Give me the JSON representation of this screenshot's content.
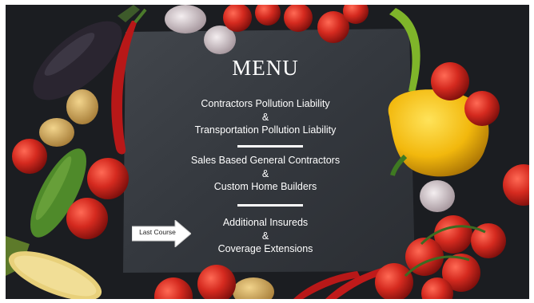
{
  "menu": {
    "title": "MENU",
    "groups": [
      {
        "line1": "Contractors Pollution Liability",
        "amp": "&",
        "line2": "Transportation Pollution Liability"
      },
      {
        "line1": "Sales Based General Contractors",
        "amp": "&",
        "line2": "Custom Home Builders"
      },
      {
        "line1": "Additional Insureds",
        "amp": "&",
        "line2": "Coverage Extensions"
      }
    ]
  },
  "pointer": {
    "label": "Last Course"
  },
  "colors": {
    "background": "#1b1d21",
    "slate": "#3a3e44",
    "tomato": "#c8281e",
    "pepper_yellow": "#f2b80d",
    "chili_red": "#b01818",
    "cucumber": "#4f8a2a",
    "eggplant": "#2a2530"
  }
}
